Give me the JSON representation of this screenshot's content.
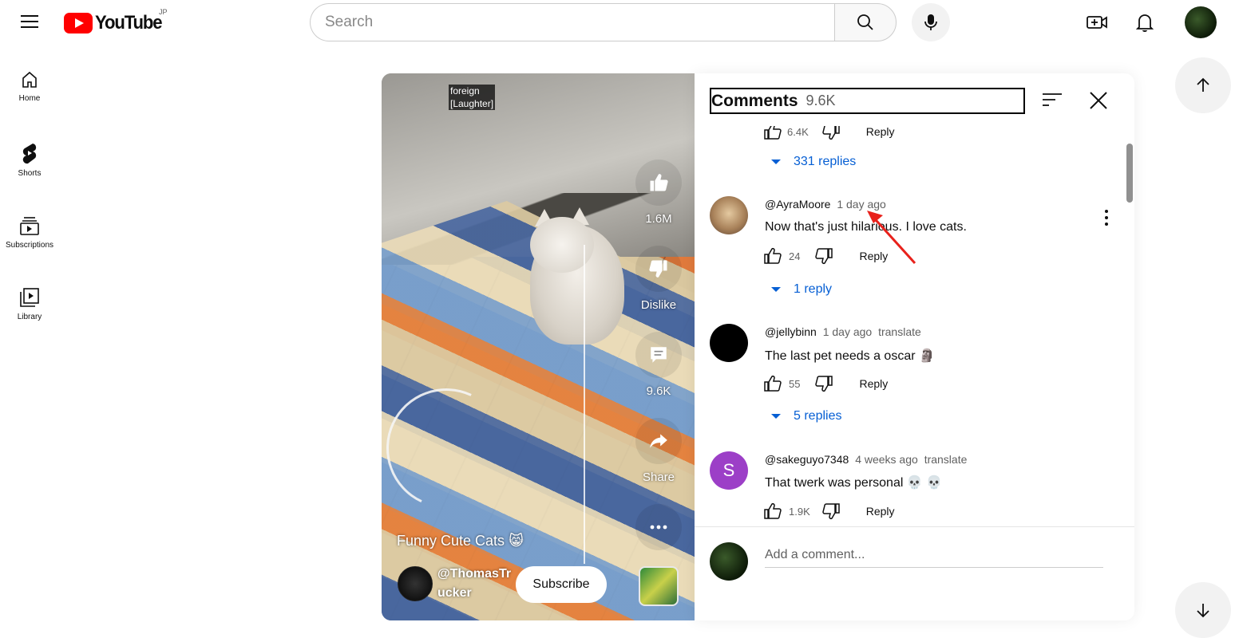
{
  "header": {
    "logo_text": "YouTube",
    "region": "JP",
    "search_placeholder": "Search"
  },
  "sidebar": {
    "items": [
      {
        "label": "Home",
        "icon": "home-icon"
      },
      {
        "label": "Shorts",
        "icon": "shorts-icon"
      },
      {
        "label": "Subscriptions",
        "icon": "subscriptions-icon"
      },
      {
        "label": "Library",
        "icon": "library-icon"
      }
    ]
  },
  "player": {
    "captions": [
      "foreign",
      "[Laughter]"
    ],
    "like_count": "1.6M",
    "dislike_label": "Dislike",
    "comment_count": "9.6K",
    "share_label": "Share",
    "title": "Funny Cute Cats 😸",
    "channel": "@ThomasTrucker",
    "subscribe_label": "Subscribe"
  },
  "comments": {
    "title": "Comments",
    "count": "9.6K",
    "partial_top": {
      "likes": "6.4K",
      "reply_label": "Reply",
      "replies_label": "331 replies"
    },
    "items": [
      {
        "author": "@AyraMoore",
        "time": "1 day ago",
        "translate": "",
        "text": "Now that's just hilarious. I love cats.",
        "likes": "24",
        "reply_label": "Reply",
        "replies_label": "1 reply",
        "avatar_color": "#c9a27a"
      },
      {
        "author": "@jellybinn",
        "time": "1 day ago",
        "translate": "translate",
        "text": "The last pet needs a oscar 🗿",
        "likes": "55",
        "reply_label": "Reply",
        "replies_label": "5 replies",
        "avatar_color": "#000000"
      },
      {
        "author": "@sakeguyo7348",
        "time": "4 weeks ago",
        "translate": "translate",
        "text": "That twerk was personal 💀 💀",
        "likes": "1.9K",
        "reply_label": "Reply",
        "replies_label": "",
        "avatar_letter": "S",
        "avatar_color": "#9c3fc7"
      }
    ],
    "add_placeholder": "Add a comment..."
  },
  "colors": {
    "brand_red": "#ff0000",
    "link_blue": "#065fd4",
    "annotation_red": "#e8211b"
  }
}
